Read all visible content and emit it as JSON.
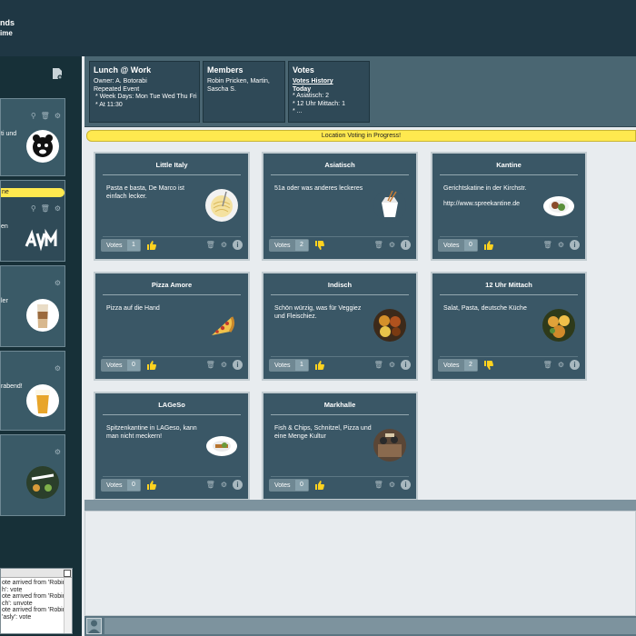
{
  "header": {
    "title_fragment": "nds",
    "subtitle_fragment": "ime"
  },
  "sidebar": {
    "cards": [
      {
        "text": "ti und",
        "image": "pizza-bear-logo"
      },
      {
        "pill": "ne",
        "text": "en",
        "image": "avm-logo"
      },
      {
        "text": "ler",
        "image": "latte-macchiato"
      },
      {
        "text": "rabend!",
        "image": "beer-glass"
      },
      {
        "text": "",
        "image": "meat-and-eat-logo"
      }
    ]
  },
  "log": {
    "lines": [
      "ote arrived from 'Robin",
      "h': vote",
      "ote arrived from 'Robin",
      "ch': unvote",
      "ote arrived from 'Robin",
      "'asly': vote"
    ]
  },
  "info": {
    "lunch": {
      "title": "Lunch @ Work",
      "lines": "Owner: A. Botorabi\nRepeated Event\n * Week Days: Mon Tue Wed Thu Fri\n * At 11:30"
    },
    "members": {
      "title": "Members",
      "lines": "Robin Pricken, Martin,\nSascha S."
    },
    "votes": {
      "title": "Votes",
      "history_link": "Votes History",
      "today_label": "Today",
      "lines": "* Asiatisch: 2\n* 12 Uhr Mittach: 1\n* ..."
    }
  },
  "banner": "Location Voting in Progress!",
  "vote_label": "Votes",
  "colors": {
    "accent_yellow": "#ffe94f",
    "card_bg": "#3a5766",
    "header_bg": "#1f3744"
  },
  "locations": [
    {
      "title": "Little Italy",
      "desc": "Pasta e basta, De Marco ist einfach lecker.",
      "sub": "",
      "votes": "1",
      "thumb": "up",
      "image": "spaghetti"
    },
    {
      "title": "Asiatisch",
      "desc": "51a oder was anderes leckeres",
      "sub": "",
      "votes": "2",
      "thumb": "down",
      "image": "noodle-box"
    },
    {
      "title": "Kantine",
      "desc": "Gerichtskatine in der Kirchstr.",
      "sub": "http://www.spreekantine.de",
      "votes": "0",
      "thumb": "up",
      "image": "plate"
    },
    {
      "title": "Pizza Amore",
      "desc": "Pizza auf die Hand",
      "sub": "",
      "votes": "0",
      "thumb": "up",
      "image": "pizza-slice"
    },
    {
      "title": "Indisch",
      "desc": "Schön würzig, was für Veggiez und Fleischiez.",
      "sub": "",
      "votes": "1",
      "thumb": "up",
      "image": "curry"
    },
    {
      "title": "12 Uhr Mittach",
      "desc": "Salat, Pasta, deutsche Küche",
      "sub": "",
      "votes": "2",
      "thumb": "down",
      "image": "salad"
    },
    {
      "title": "LAGeSo",
      "desc": "Spitzenkantine in LAGeso, kann man nicht meckern!",
      "sub": "",
      "votes": "0",
      "thumb": "up",
      "image": "plate-dish"
    },
    {
      "title": "Markhalle",
      "desc": "Fish & Chips, Schnitzel, Pizza und eine Menge Kultur",
      "sub": "",
      "votes": "0",
      "thumb": "up",
      "image": "market-hall"
    }
  ]
}
